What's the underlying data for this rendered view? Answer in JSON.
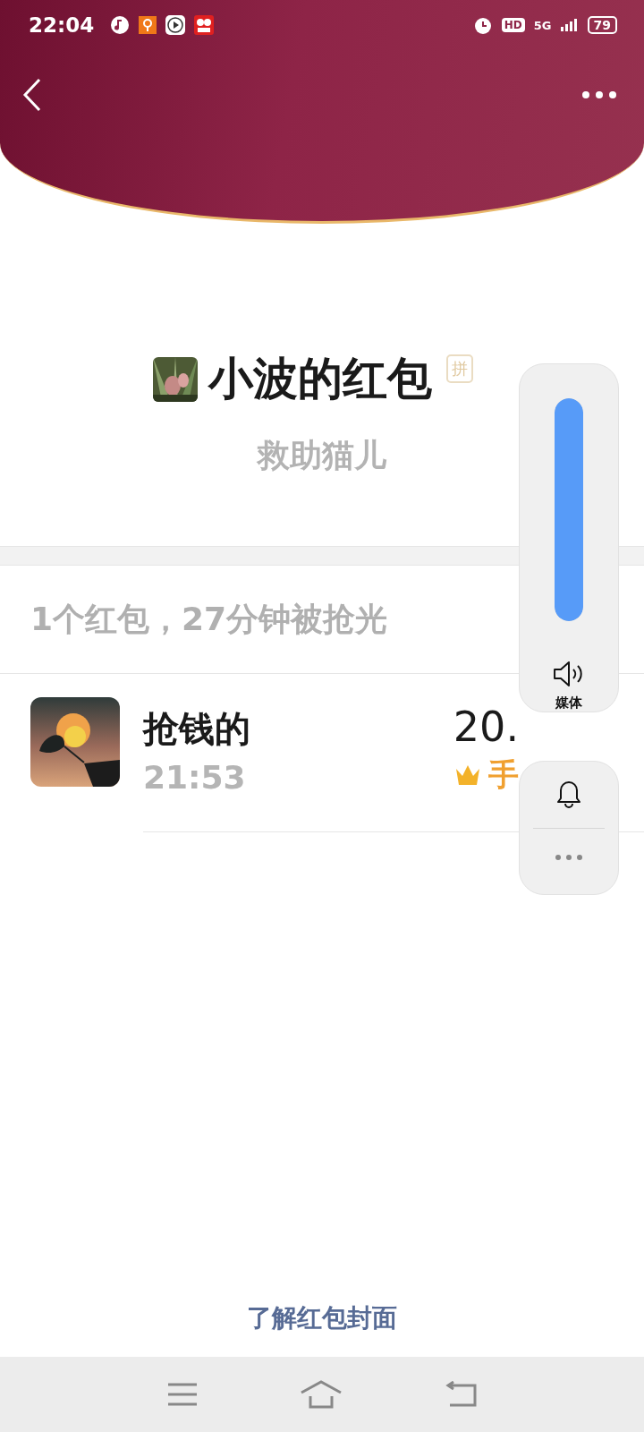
{
  "status_bar": {
    "time": "22:04",
    "hd": "HD",
    "network": "5G",
    "battery": "79"
  },
  "packet": {
    "sender": "小波的红包",
    "badge": "拼",
    "message": "救助猫儿"
  },
  "summary": "1个红包，27分钟被抢光",
  "claims": [
    {
      "name": "抢钱的",
      "time": "21:53",
      "amount": "20.",
      "best_luck": true,
      "best_luck_label": "手"
    }
  ],
  "footer_link": "了解红包封面",
  "volume_panel": {
    "level": 1,
    "label": "媒体"
  }
}
